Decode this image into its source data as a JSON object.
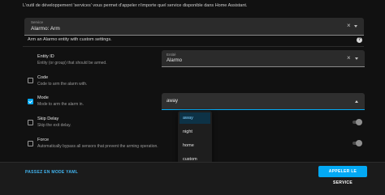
{
  "intro_text": "L'outil de développement 'services' vous permet d'appeler n'importe quel service disponible dans Home Assistant.",
  "service": {
    "label": "Service",
    "value": "Alarmo: Arm"
  },
  "service_description": "Arm an Alarmo entity with custom settings.",
  "fields": {
    "entity": {
      "title": "Entity ID",
      "subtitle": "Entity (or group) that should be armed.",
      "input_label": "Entité",
      "input_value": "Alarmo"
    },
    "code": {
      "title": "Code",
      "subtitle": "Code to arm the alarm with.",
      "checked": false
    },
    "mode": {
      "title": "Mode",
      "subtitle": "Mode to arm the alarm in.",
      "checked": true,
      "value": "away",
      "options": [
        "away",
        "night",
        "home",
        "custom"
      ],
      "selected_index": 0
    },
    "skip_delay": {
      "title": "Skip Delay",
      "subtitle": "Skip the exit delay.",
      "checked": false
    },
    "force": {
      "title": "Force",
      "subtitle": "Automatically bypass all sensors that prevent the arming operation.",
      "checked": false
    }
  },
  "footer": {
    "yaml_mode_label": "PASSEZ EN MODE YAML",
    "call_service_label": "APPELER LE SERVICE"
  },
  "colors": {
    "accent": "#03a9f4",
    "background": "#111111",
    "field_bg": "#2b2b2b"
  },
  "icons": [
    "clear-icon",
    "chevron-down-icon",
    "chevron-up-icon",
    "help-icon",
    "checkbox-icon"
  ]
}
